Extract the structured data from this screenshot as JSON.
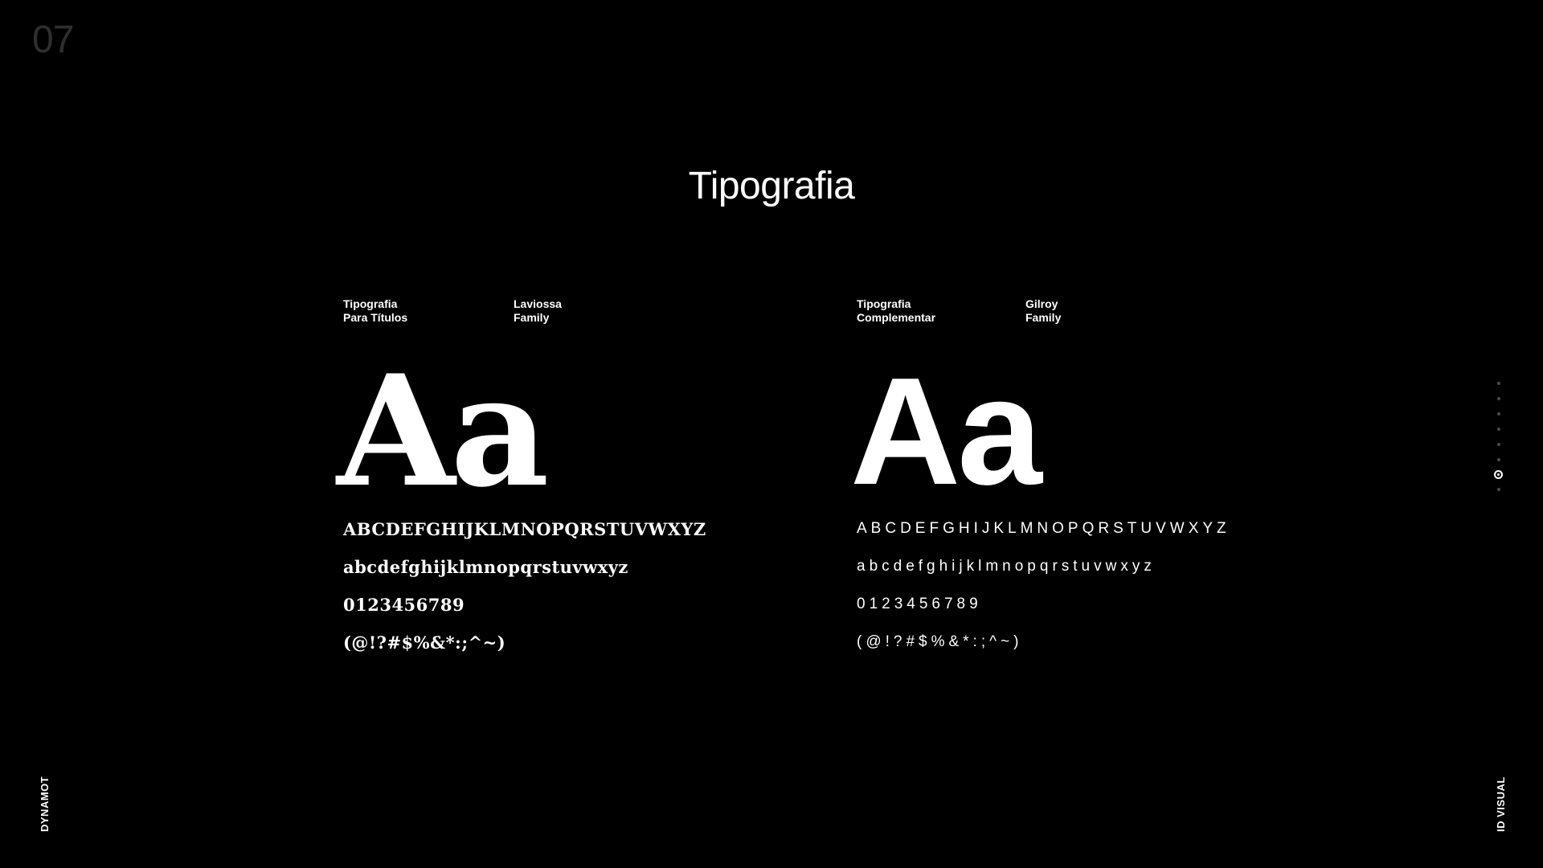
{
  "page_number": "07",
  "title": "Tipografia",
  "left": {
    "label_line1": "Tipografia",
    "label_line2": "Para Títulos",
    "family_line1": "Laviossa",
    "family_line2": "Family",
    "specimen": "Aa",
    "uppercase": "ABCDEFGHIJKLMNOPQRSTUVWXYZ",
    "lowercase": "abcdefghijklmnopqrstuvwxyz",
    "numbers": "0123456789",
    "symbols": "(@!?#$%&*:;^~)"
  },
  "right": {
    "label_line1": "Tipografia",
    "label_line2": "Complementar",
    "family_line1": "Gilroy",
    "family_line2": "Family",
    "specimen": "Aa",
    "uppercase": "ABCDEFGHIJKLMNOPQRSTUVWXYZ",
    "lowercase": "abcdefghijklmnopqrstuvwxyz",
    "numbers": "0123456789",
    "symbols": "(@!?#$%&*:;^~)"
  },
  "side_left": "DYNAMOT",
  "side_right": "ID VISUAL",
  "pagination": {
    "total": 8,
    "active_index": 6
  },
  "colors": {
    "background": "#000000",
    "text": "#ffffff",
    "muted": "#2e2e2e"
  }
}
